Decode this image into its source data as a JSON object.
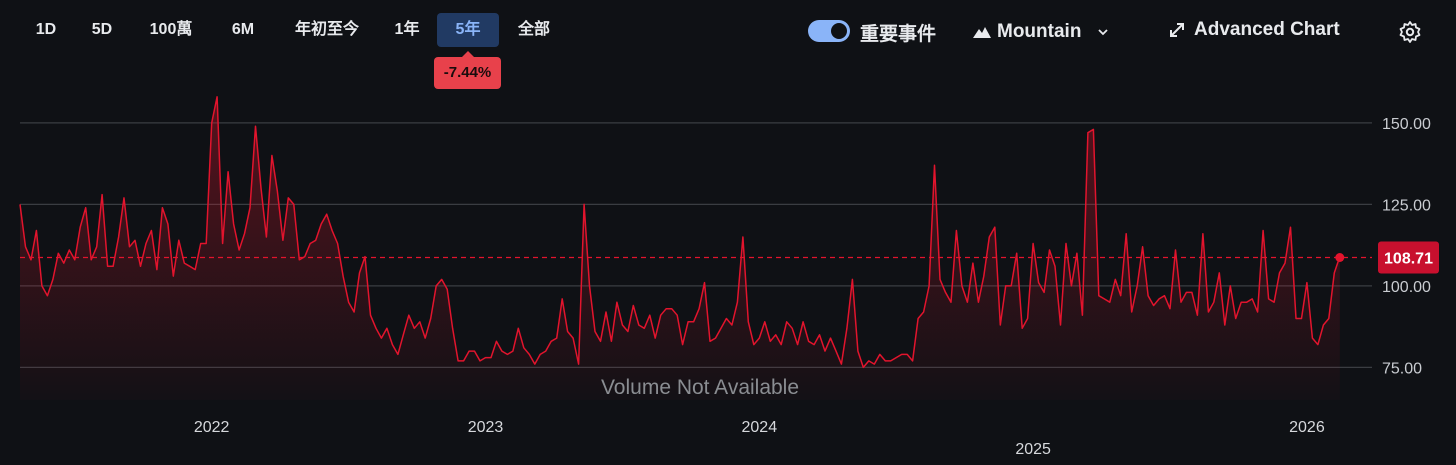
{
  "toolbar": {
    "ranges": [
      "1D",
      "5D",
      "100萬",
      "6M",
      "年初至今",
      "1年",
      "5年",
      "全部"
    ],
    "active_range": "5年",
    "change_badge": "-7.44%",
    "events_toggle_label": "重要事件",
    "events_toggle_on": true,
    "chart_type_label": "Mountain",
    "advanced_chart_label": "Advanced Chart"
  },
  "chart_data": {
    "type": "area",
    "ylim": [
      65,
      165
    ],
    "y_ticks": [
      75,
      100,
      125,
      150
    ],
    "y_tick_labels": [
      "75.00",
      "100.00",
      "125.00",
      "150.00"
    ],
    "x_range": [
      2021.3,
      2026.15
    ],
    "x_ticks": [
      2022,
      2023,
      2024,
      2025,
      2026
    ],
    "x_tick_labels": [
      "2022",
      "2023",
      "2024",
      "2025",
      "2026"
    ],
    "last_price": 108.71,
    "last_price_label": "108.71",
    "volume_note": "Volume Not Available",
    "grid": true,
    "colors": {
      "line": "#e2142d",
      "price_badge": "#c8102e",
      "active_tab": "#213a63"
    },
    "x": [
      2021.3,
      2021.32,
      2021.34,
      2021.36,
      2021.38,
      2021.4,
      2021.42,
      2021.44,
      2021.46,
      2021.48,
      2021.5,
      2021.52,
      2021.54,
      2021.56,
      2021.58,
      2021.6,
      2021.62,
      2021.64,
      2021.66,
      2021.68,
      2021.7,
      2021.72,
      2021.74,
      2021.76,
      2021.78,
      2021.8,
      2021.82,
      2021.84,
      2021.86,
      2021.88,
      2021.9,
      2021.92,
      2021.94,
      2021.96,
      2021.98,
      2022.0,
      2022.02,
      2022.04,
      2022.06,
      2022.08,
      2022.1,
      2022.12,
      2022.14,
      2022.16,
      2022.18,
      2022.2,
      2022.22,
      2022.24,
      2022.26,
      2022.28,
      2022.3,
      2022.32,
      2022.34,
      2022.36,
      2022.38,
      2022.4,
      2022.42,
      2022.44,
      2022.46,
      2022.48,
      2022.5,
      2022.52,
      2022.54,
      2022.56,
      2022.58,
      2022.6,
      2022.62,
      2022.64,
      2022.66,
      2022.68,
      2022.7,
      2022.72,
      2022.74,
      2022.76,
      2022.78,
      2022.8,
      2022.82,
      2022.84,
      2022.86,
      2022.88,
      2022.9,
      2022.92,
      2022.94,
      2022.96,
      2022.98,
      2023.0,
      2023.02,
      2023.04,
      2023.06,
      2023.08,
      2023.1,
      2023.12,
      2023.14,
      2023.16,
      2023.18,
      2023.2,
      2023.22,
      2023.24,
      2023.26,
      2023.28,
      2023.3,
      2023.32,
      2023.34,
      2023.36,
      2023.38,
      2023.4,
      2023.42,
      2023.44,
      2023.46,
      2023.48,
      2023.5,
      2023.52,
      2023.54,
      2023.56,
      2023.58,
      2023.6,
      2023.62,
      2023.64,
      2023.66,
      2023.68,
      2023.7,
      2023.72,
      2023.74,
      2023.76,
      2023.78,
      2023.8,
      2023.82,
      2023.84,
      2023.86,
      2023.88,
      2023.9,
      2023.92,
      2023.94,
      2023.96,
      2023.98,
      2024.0,
      2024.02,
      2024.04,
      2024.06,
      2024.08,
      2024.1,
      2024.12,
      2024.14,
      2024.16,
      2024.18,
      2024.2,
      2024.22,
      2024.24,
      2024.26,
      2024.28,
      2024.3,
      2024.32,
      2024.34,
      2024.36,
      2024.38,
      2024.4,
      2024.42,
      2024.44,
      2024.46,
      2024.48,
      2024.5,
      2024.52,
      2024.54,
      2024.56,
      2024.58,
      2024.6,
      2024.62,
      2024.64,
      2024.66,
      2024.68,
      2024.7,
      2024.72,
      2024.74,
      2024.76,
      2024.78,
      2024.8,
      2024.82,
      2024.84,
      2024.86,
      2024.88,
      2024.9,
      2024.92,
      2024.94,
      2024.96,
      2024.98,
      2025.0,
      2025.02,
      2025.04,
      2025.06,
      2025.08,
      2025.1,
      2025.12,
      2025.14,
      2025.16,
      2025.18,
      2025.2,
      2025.22,
      2025.24,
      2025.26,
      2025.28,
      2025.3,
      2025.32,
      2025.34,
      2025.36,
      2025.38,
      2025.4,
      2025.42,
      2025.44,
      2025.46,
      2025.48,
      2025.5,
      2025.52,
      2025.54,
      2025.56,
      2025.58,
      2025.6,
      2025.62,
      2025.64,
      2025.66,
      2025.68,
      2025.7,
      2025.72,
      2025.74,
      2025.76,
      2025.78,
      2025.8,
      2025.82,
      2025.84,
      2025.86,
      2025.88,
      2025.9,
      2025.92,
      2025.94,
      2025.96,
      2025.98,
      2026.0,
      2026.02,
      2026.04,
      2026.06,
      2026.08,
      2026.1,
      2026.12
    ],
    "values": [
      125,
      112,
      108,
      117,
      100,
      97,
      102,
      110,
      107,
      111,
      108,
      118,
      124,
      108,
      112,
      128,
      106,
      106,
      115,
      127,
      112,
      114,
      106,
      113,
      117,
      105,
      124,
      119,
      103,
      114,
      107,
      106,
      105,
      113,
      113,
      150,
      158,
      113,
      135,
      119,
      111,
      116,
      124,
      149,
      130,
      115,
      140,
      129,
      114,
      127,
      125,
      108,
      109,
      113,
      114,
      119,
      122,
      117,
      113,
      103,
      95,
      92,
      104,
      109,
      91,
      87,
      84,
      87,
      82,
      79,
      85,
      91,
      87,
      89,
      84,
      90,
      100,
      102,
      99,
      87,
      77,
      77,
      80,
      80,
      77,
      78,
      78,
      83,
      80,
      79,
      80,
      87,
      81,
      79,
      76,
      79,
      80,
      83,
      84,
      96,
      86,
      84,
      76,
      125,
      100,
      86,
      83,
      92,
      83,
      95,
      88,
      86,
      94,
      88,
      87,
      91,
      84,
      91,
      93,
      93,
      91,
      82,
      89,
      89,
      93,
      101,
      83,
      84,
      87,
      90,
      88,
      95,
      115,
      89,
      82,
      84,
      89,
      83,
      85,
      82,
      89,
      87,
      82,
      89,
      83,
      82,
      85,
      80,
      84,
      80,
      76,
      87,
      102,
      80,
      75,
      77,
      76,
      79,
      77,
      77,
      78,
      79,
      79,
      77,
      90,
      92,
      100,
      137,
      102,
      98,
      95,
      117,
      100,
      95,
      107,
      95,
      103,
      115,
      118,
      88,
      100,
      100,
      110,
      87,
      90,
      113,
      101,
      98,
      111,
      106,
      88,
      113,
      100,
      110,
      91,
      147,
      148,
      97,
      96,
      95,
      102,
      97,
      116,
      92,
      100,
      112,
      97,
      94,
      96,
      97,
      93,
      111,
      95,
      98,
      98,
      91,
      116,
      92,
      95,
      104,
      88,
      100,
      90,
      95,
      95,
      96,
      92,
      117,
      96,
      95,
      104,
      107,
      118,
      90,
      90,
      101,
      84,
      82,
      88,
      90,
      104,
      109,
      101,
      114,
      112,
      108,
      108.71
    ]
  }
}
